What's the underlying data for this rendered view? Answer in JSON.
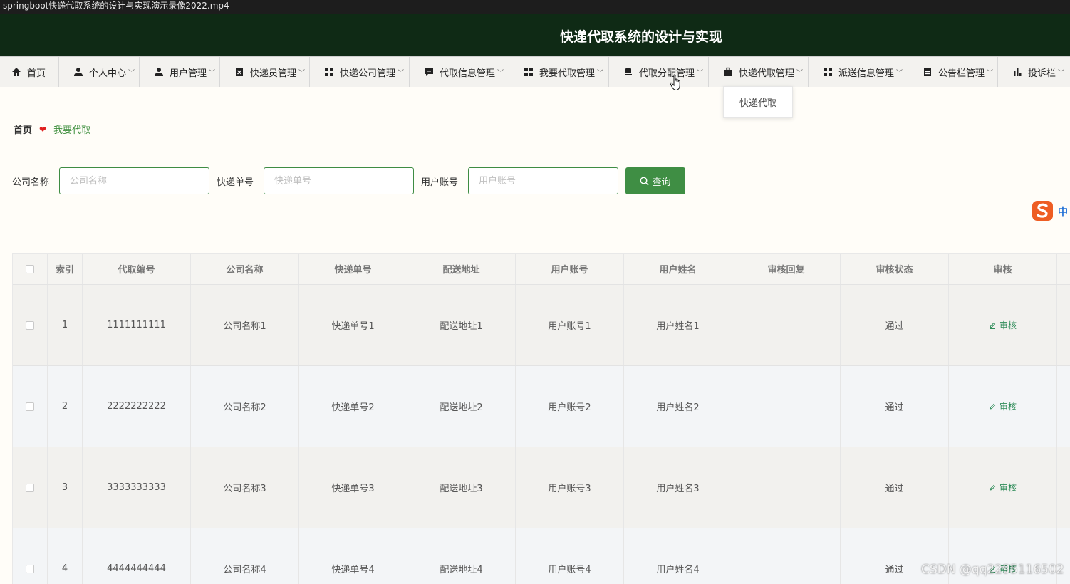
{
  "video_title": "springboot快递代取系统的设计与实现演示录像2022.mp4",
  "app": {
    "title": "快递代取系统的设计与实现"
  },
  "nav": [
    {
      "label": "首页",
      "icon": "home-icon"
    },
    {
      "label": "个人中心",
      "icon": "user-icon"
    },
    {
      "label": "用户管理",
      "icon": "user-icon"
    },
    {
      "label": "快递员管理",
      "icon": "courier-icon"
    },
    {
      "label": "快递公司管理",
      "icon": "grid-icon"
    },
    {
      "label": "代取信息管理",
      "icon": "message-icon"
    },
    {
      "label": "我要代取管理",
      "icon": "grid-icon"
    },
    {
      "label": "代取分配管理",
      "icon": "stamp-icon"
    },
    {
      "label": "快递代取管理",
      "icon": "briefcase-icon"
    },
    {
      "label": "派送信息管理",
      "icon": "grid-icon"
    },
    {
      "label": "公告栏管理",
      "icon": "clipboard-icon"
    },
    {
      "label": "投诉栏",
      "icon": "bar-chart-icon"
    }
  ],
  "dropdown": {
    "item": "快递代取"
  },
  "breadcrumb": {
    "home": "首页",
    "current": "我要代取"
  },
  "search": {
    "company_label": "公司名称",
    "company_placeholder": "公司名称",
    "tracking_label": "快递单号",
    "tracking_placeholder": "快递单号",
    "account_label": "用户账号",
    "account_placeholder": "用户账号",
    "query_label": "查询"
  },
  "ime": {
    "text": "中"
  },
  "table": {
    "headers": [
      "索引",
      "代取编号",
      "公司名称",
      "快递单号",
      "配送地址",
      "用户账号",
      "用户姓名",
      "审核回复",
      "审核状态",
      "审核"
    ],
    "rows": [
      {
        "index": "1",
        "code": "1111111111",
        "company": "公司名称1",
        "tracking": "快递单号1",
        "address": "配送地址1",
        "account": "用户账号1",
        "name": "用户姓名1",
        "reply": "",
        "status": "通过",
        "action": "审核"
      },
      {
        "index": "2",
        "code": "2222222222",
        "company": "公司名称2",
        "tracking": "快递单号2",
        "address": "配送地址2",
        "account": "用户账号2",
        "name": "用户姓名2",
        "reply": "",
        "status": "通过",
        "action": "审核"
      },
      {
        "index": "3",
        "code": "3333333333",
        "company": "公司名称3",
        "tracking": "快递单号3",
        "address": "配送地址3",
        "account": "用户账号3",
        "name": "用户姓名3",
        "reply": "",
        "status": "通过",
        "action": "审核"
      },
      {
        "index": "4",
        "code": "4444444444",
        "company": "公司名称4",
        "tracking": "快递单号4",
        "address": "配送地址4",
        "account": "用户账号4",
        "name": "用户姓名4",
        "reply": "",
        "status": "通过",
        "action": "审核"
      }
    ]
  },
  "watermark": "CSDN @qq2295116502"
}
